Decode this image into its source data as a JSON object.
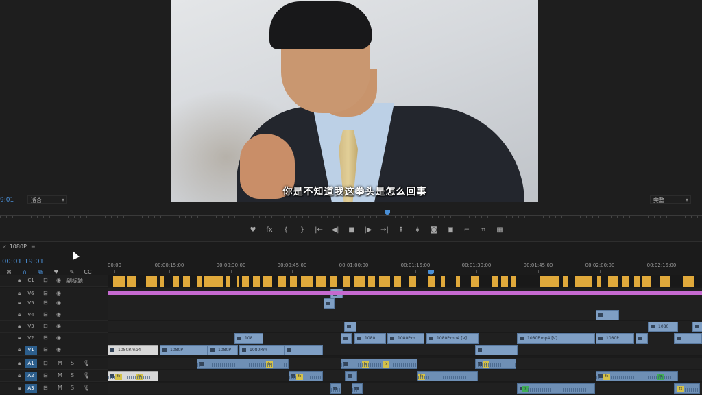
{
  "program_monitor": {
    "subtitle": "你是不知道我这拳头是怎么回事",
    "timecode": "9:01",
    "fit_dropdown": "适合",
    "quality_dropdown": "完整"
  },
  "transport": [
    {
      "name": "marker-icon",
      "glyph": "♥"
    },
    {
      "name": "fx-icon",
      "glyph": "fx"
    },
    {
      "name": "mark-in-icon",
      "glyph": "{"
    },
    {
      "name": "mark-out-icon",
      "glyph": "}"
    },
    {
      "name": "go-to-in-icon",
      "glyph": "|←"
    },
    {
      "name": "step-back-icon",
      "glyph": "◀|"
    },
    {
      "name": "stop-icon",
      "glyph": "■"
    },
    {
      "name": "step-forward-icon",
      "glyph": "|▶"
    },
    {
      "name": "go-to-out-icon",
      "glyph": "→|"
    },
    {
      "name": "lift-icon",
      "glyph": "⇞"
    },
    {
      "name": "extract-icon",
      "glyph": "⇟"
    },
    {
      "name": "camera-icon",
      "glyph": "◙"
    },
    {
      "name": "compare-icon",
      "glyph": "▣"
    },
    {
      "name": "trim-icon",
      "glyph": "⌐"
    },
    {
      "name": "settings-icon",
      "glyph": "⌗"
    },
    {
      "name": "vr-icon",
      "glyph": "▦"
    }
  ],
  "sequence": {
    "tab_name": "1080P",
    "timecode": "00:01:19:01"
  },
  "ruler": [
    "00:00",
    "00:00:15:00",
    "00:00:30:00",
    "00:00:45:00",
    "00:01:00:00",
    "00:01:15:00",
    "00:01:30:00",
    "00:01:45:00",
    "00:02:00:00",
    "00:02:15:00"
  ],
  "tracks": [
    {
      "id": "C1",
      "type": "caption",
      "label": "副标题"
    },
    {
      "id": "V6",
      "type": "video"
    },
    {
      "id": "V5",
      "type": "video"
    },
    {
      "id": "V4",
      "type": "video"
    },
    {
      "id": "V3",
      "type": "video"
    },
    {
      "id": "V2",
      "type": "video"
    },
    {
      "id": "V1",
      "type": "video",
      "active": true
    },
    {
      "id": "A1",
      "type": "audio",
      "active": true
    },
    {
      "id": "A2",
      "type": "audio",
      "active": true
    },
    {
      "id": "A3",
      "type": "audio",
      "active": true
    }
  ],
  "clip_labels": {
    "v1_a": "1080P.mp4",
    "v1_b": "1080P",
    "v1_c": "1080P",
    "v1_d": "1080P.m",
    "v2_a": "108",
    "v2_b": "1080",
    "v2_c": "1080P.m",
    "v2_d": "1080P.mp4 [V]",
    "v2_e": "1080P.mp4 [V]",
    "v2_f": "1080P",
    "v3_a": "1080",
    "fx": "fx"
  }
}
